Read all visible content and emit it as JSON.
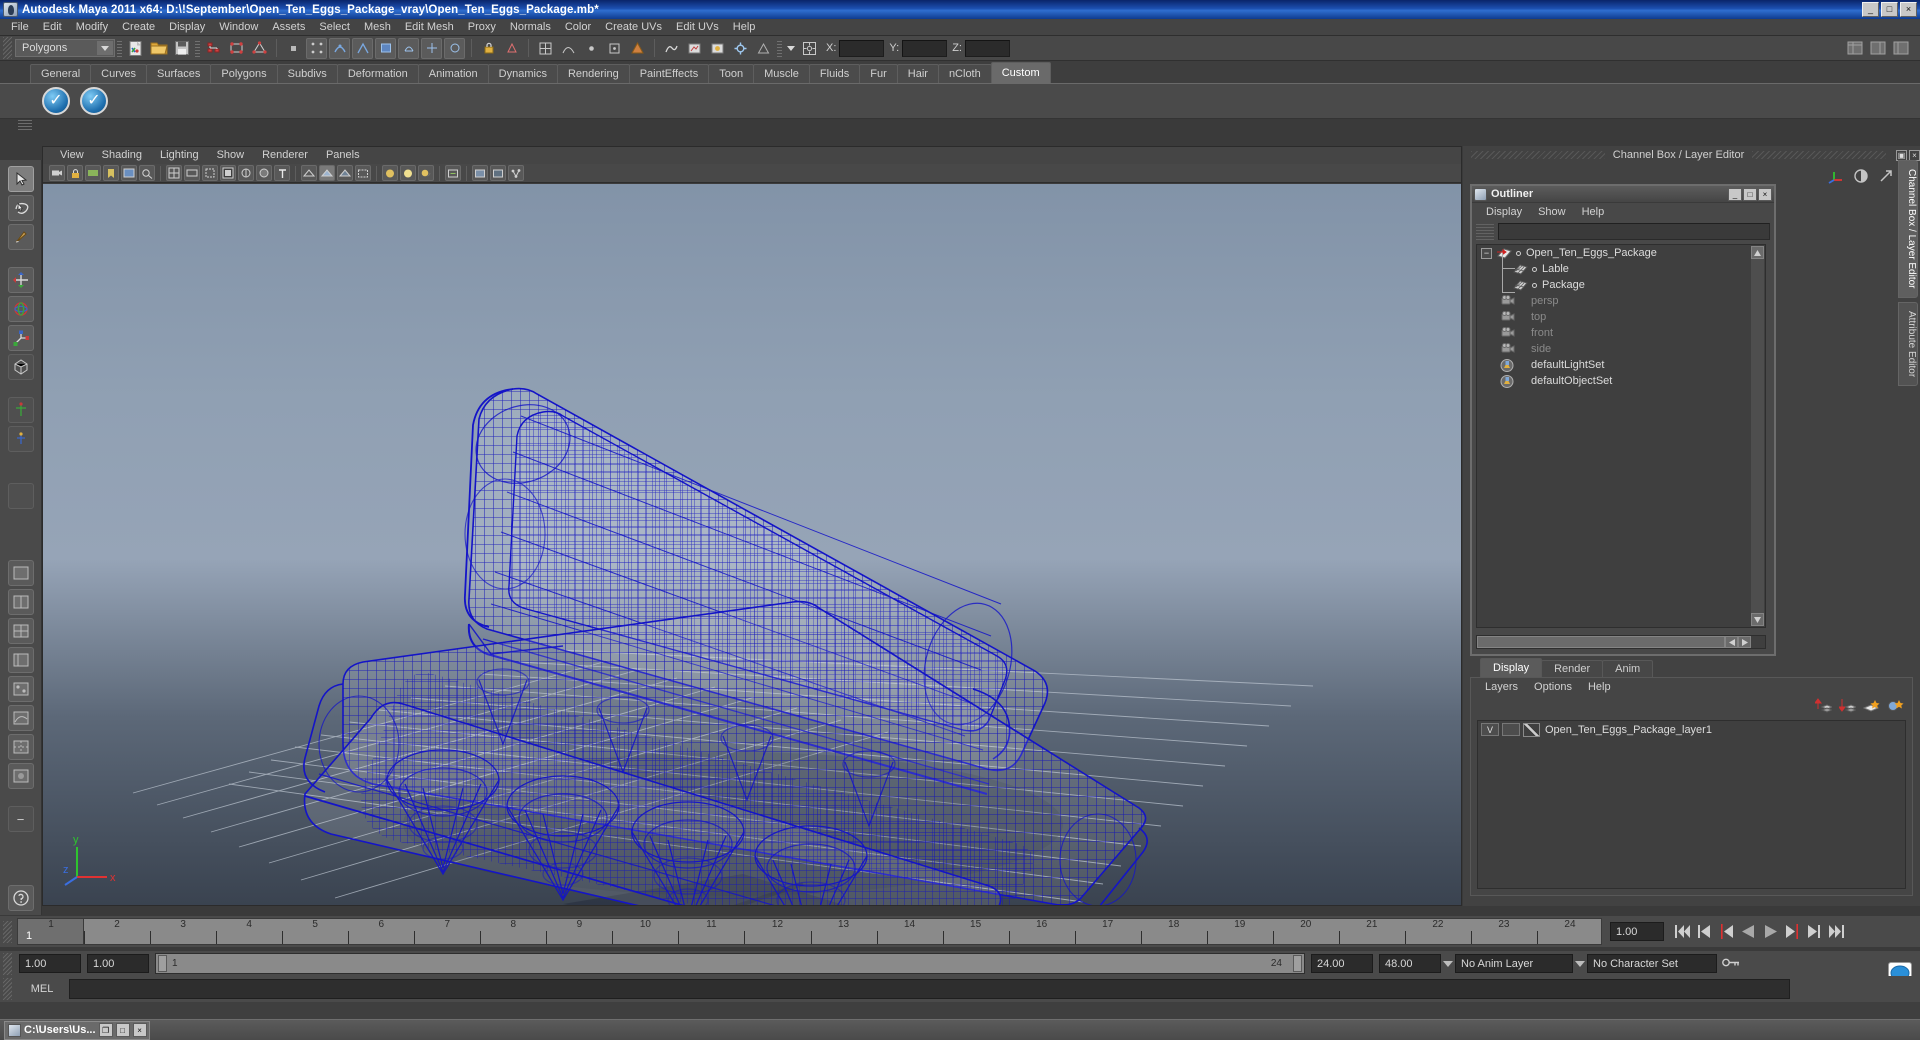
{
  "window": {
    "title": "Autodesk Maya 2011 x64: D:\\!September\\Open_Ten_Eggs_Package_vray\\Open_Ten_Eggs_Package.mb*",
    "minimize": "_",
    "maximize": "□",
    "close": "×",
    "app_icon": "maya-icon"
  },
  "menubar": {
    "items": [
      "File",
      "Edit",
      "Modify",
      "Create",
      "Display",
      "Window",
      "Assets",
      "Select",
      "Mesh",
      "Edit Mesh",
      "Proxy",
      "Normals",
      "Color",
      "Create UVs",
      "Edit UVs",
      "Help"
    ]
  },
  "statusbar": {
    "menu_set": "Polygons",
    "coord_labels": {
      "x": "X:",
      "y": "Y:",
      "z": "Z:"
    },
    "coord_values": {
      "x": "",
      "y": "",
      "z": ""
    }
  },
  "shelf": {
    "tabs": [
      "General",
      "Curves",
      "Surfaces",
      "Polygons",
      "Subdivs",
      "Deformation",
      "Animation",
      "Dynamics",
      "Rendering",
      "PaintEffects",
      "Toon",
      "Muscle",
      "Fluids",
      "Fur",
      "Hair",
      "nCloth",
      "Custom"
    ],
    "active_tab": "Custom",
    "buttons": [
      "vray-sphere-icon",
      "vray-sphere-icon"
    ]
  },
  "viewport": {
    "menus": [
      "View",
      "Shading",
      "Lighting",
      "Show",
      "Renderer",
      "Panels"
    ],
    "axis": {
      "y": "y",
      "x": "x",
      "z": "z"
    },
    "scene_description": "Wireframe egg carton package, blue wireframe on grey gradient background with ground grid"
  },
  "channel_box": {
    "header": "Channel Box / Layer Editor",
    "restore_label": "▣",
    "close_label": "×"
  },
  "outliner": {
    "title": "Outliner",
    "icon": "outliner-icon",
    "window_buttons": {
      "minimize": "_",
      "maximize": "□",
      "close": "×"
    },
    "menus": [
      "Display",
      "Show",
      "Help"
    ],
    "search_value": "",
    "tree": [
      {
        "label": "Open_Ten_Eggs_Package",
        "depth": 0,
        "expander": "−",
        "icon": "transform-icon",
        "dimmed": false,
        "has_dot": true
      },
      {
        "label": "Lable",
        "depth": 1,
        "expander": "",
        "icon": "mesh-icon",
        "dimmed": false,
        "has_dot": true
      },
      {
        "label": "Package",
        "depth": 1,
        "expander": "",
        "icon": "mesh-icon",
        "dimmed": false,
        "has_dot": true
      },
      {
        "label": "persp",
        "depth": 0,
        "expander": "",
        "icon": "camera-icon",
        "dimmed": true,
        "has_dot": false
      },
      {
        "label": "top",
        "depth": 0,
        "expander": "",
        "icon": "camera-icon",
        "dimmed": true,
        "has_dot": false
      },
      {
        "label": "front",
        "depth": 0,
        "expander": "",
        "icon": "camera-icon",
        "dimmed": true,
        "has_dot": false
      },
      {
        "label": "side",
        "depth": 0,
        "expander": "",
        "icon": "camera-icon",
        "dimmed": true,
        "has_dot": false
      },
      {
        "label": "defaultLightSet",
        "depth": 0,
        "expander": "",
        "icon": "set-icon",
        "dimmed": false,
        "has_dot": false
      },
      {
        "label": "defaultObjectSet",
        "depth": 0,
        "expander": "",
        "icon": "set-icon",
        "dimmed": false,
        "has_dot": false
      }
    ]
  },
  "layer_editor": {
    "tabs": [
      "Display",
      "Render",
      "Anim"
    ],
    "active_tab": "Display",
    "menus": [
      "Layers",
      "Options",
      "Help"
    ],
    "toolbar_icons": [
      "move-layer-up-icon",
      "move-layer-down-icon",
      "new-layer-icon",
      "new-layer-from-selected-icon"
    ],
    "layers": [
      {
        "visibility": "V",
        "playback": "",
        "name": "Open_Ten_Eggs_Package_layer1"
      }
    ]
  },
  "dock_tabs": {
    "items": [
      "Channel Box / Layer Editor",
      "Attribute Editor"
    ],
    "active": "Channel Box / Layer Editor"
  },
  "time_slider": {
    "current_frame": "1",
    "tick_labels": [
      "1",
      "2",
      "3",
      "4",
      "5",
      "6",
      "7",
      "8",
      "9",
      "10",
      "11",
      "12",
      "13",
      "14",
      "15",
      "16",
      "17",
      "18",
      "19",
      "20",
      "21",
      "22",
      "23",
      "24"
    ],
    "current_time_field": "1.00",
    "playback_buttons": [
      "go-to-start-icon",
      "step-back-frame-icon",
      "step-back-key-icon",
      "play-backwards-icon",
      "play-forwards-icon",
      "step-forward-key-icon",
      "step-forward-frame-icon",
      "go-to-end-icon"
    ]
  },
  "range_slider": {
    "start_field": "1.00",
    "playback_start_field": "1.00",
    "range_start_label": "1",
    "range_end_label": "24",
    "playback_end_field": "24.00",
    "end_field": "48.00",
    "anim_layer": "No Anim Layer",
    "character_set": "No Character Set",
    "key_icon": "key-icon"
  },
  "command_line": {
    "label": "MEL",
    "value": ""
  },
  "taskbar": {
    "button_label": "C:\\Users\\Us...",
    "button_icon": "maya-icon",
    "window_buttons": {
      "restore": "❐",
      "maximize": "□",
      "close": "×"
    }
  },
  "colors": {
    "title_blue": "#1c4fb0",
    "panel_grey": "#4a4a4a",
    "wireframe_blue": "#1414c8",
    "accent_text": "#d2d2d2"
  }
}
